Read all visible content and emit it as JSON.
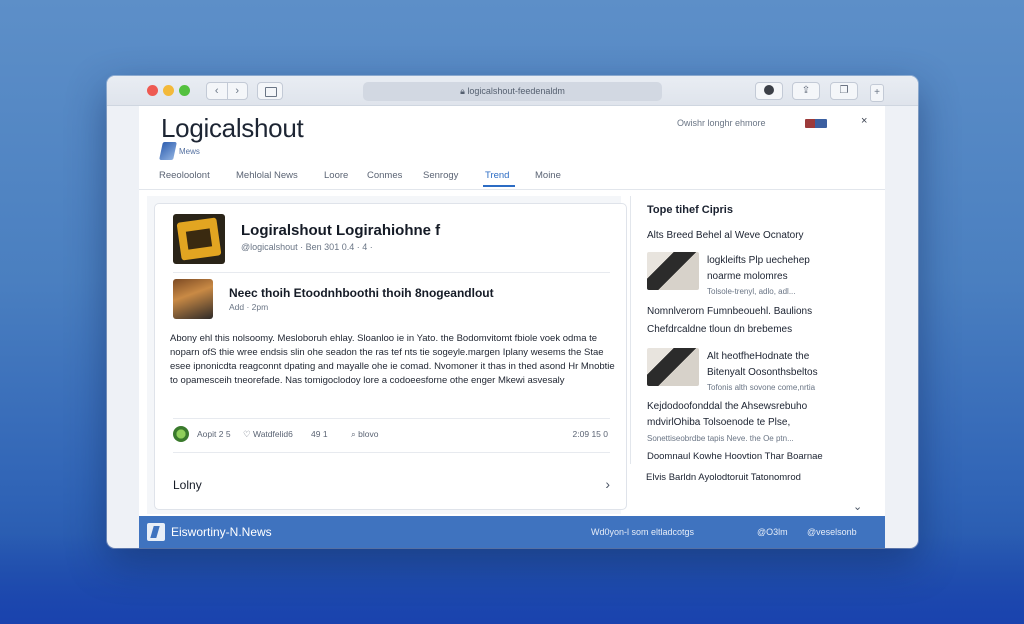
{
  "browser": {
    "url": "logicalshout-feedenaldm",
    "nav_back": "‹",
    "nav_forward": "›"
  },
  "header": {
    "brand": "Logicalshout",
    "brand_sub": "Mews",
    "top_right": "Owishr longhr ehmore",
    "close": "×"
  },
  "nav": {
    "items": [
      {
        "label": "Reeoloolont"
      },
      {
        "label": "Mehlolal News"
      },
      {
        "label": "Loore"
      },
      {
        "label": "Conmes"
      },
      {
        "label": "Senrogy"
      },
      {
        "label": "Trend"
      },
      {
        "label": "Moine"
      }
    ]
  },
  "post": {
    "title": "Logiralshout Logirahiohne f",
    "meta": "@logicalshout · Ben 301 0.4 · 4 ·",
    "sub_title": "Neec thoih Etoodnhboothi thoih 8nogeandlout",
    "sub_meta": "Add · 2pm",
    "body": "Abony ehl this nolsoomy. Mesloboruh ehlay. Sloanloo ie in Yato. the Bodomvitomt fbiole voek odma te noparn ofS thie wree endsis slin ohe seadon the ras tef nts tie sogeyle.margen Iplany wesems the Stae esee ipnonicdta reagconnt dpating and mayalle ohe ie comad. Nvomoner it thas in thed asond Hr Mnobtie to opamesceih tneorefade. Nas tomigoclodoy lore a codoeesforne othe enger Mkewi asvesaly",
    "action_a": "Aopit 2 5",
    "action_b": "♡ Watdfelid6",
    "action_c": "49 1",
    "action_d": "⌕ blovo",
    "time": "2:09 15 0",
    "lol": "Lolny",
    "chevron": "›"
  },
  "trending": {
    "heading": "Tope tihef Cipris",
    "item1": "Alts Breed Behel al Weve Ocnatory",
    "t1_line1": "logkleifts Plp uechehep",
    "t1_line2": "noarme molomres",
    "t1_small": "Tolsole-trenyl, adlo, adl...",
    "plain1_line1": "Nomnlverorn Fumnbeouehl. Baulions",
    "plain1_line2": "Chefdrcaldne tloun dn brebemes",
    "t2_line1": "Alt heotfheHodnate the",
    "t2_line2": "Bitenyalt Oosonthsbeltos",
    "t2_small": "Tofonis alth sovone come,nrtia",
    "plain2_line1": "Kejdodoofonddal the Ahsewsrebuho",
    "plain2_line2": "mdvirlOhiba Tolsoenode te Plse,",
    "plain2_small": "Sonettiseobrdbe tapis Neve. the Oe ptn...",
    "plain3_line1": "Doomnaul Kowhe Hoovtion Thar Boarnae",
    "plain3_line2": "Elvis Barldn Ayolodtoruit Tatonomrod",
    "scroll": "⌄"
  },
  "footer": {
    "brand": "Eiswortiny-N.News",
    "link1": "Wd0yon-l som eltladcotgs",
    "link2": "@O3lm",
    "link3": "@veselsonb"
  }
}
